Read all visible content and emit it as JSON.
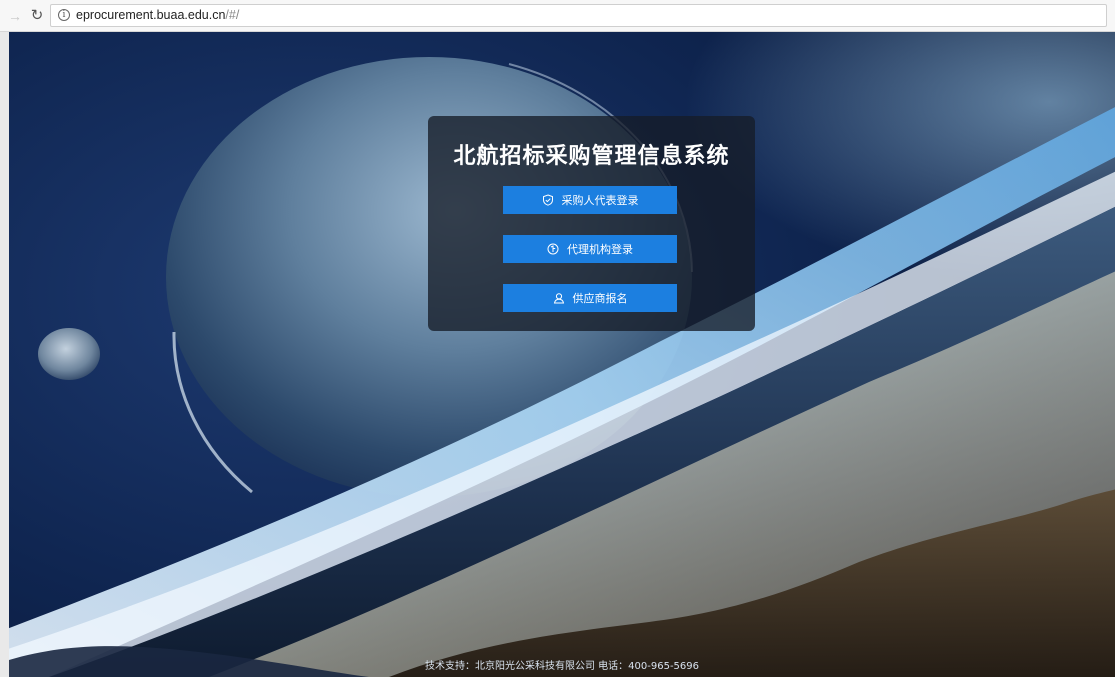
{
  "browser": {
    "url_host": "eprocurement.buaa.edu.cn",
    "url_path": "/#/",
    "info_glyph": "i",
    "back_icon": "back-arrow-icon",
    "reload_icon": "reload-icon"
  },
  "page": {
    "title": "北航招标采购管理信息系统",
    "buttons": [
      {
        "label": "采购人代表登录",
        "icon": "shield-check-icon"
      },
      {
        "label": "代理机构登录",
        "icon": "agency-badge-icon"
      },
      {
        "label": "供应商报名",
        "icon": "user-icon"
      }
    ],
    "footer": "技术支持：北京阳光公采科技有限公司 电话：400-965-5696"
  },
  "colors": {
    "button_bg": "#1c7fe0",
    "panel_bg": "rgba(22,28,40,0.78)"
  }
}
